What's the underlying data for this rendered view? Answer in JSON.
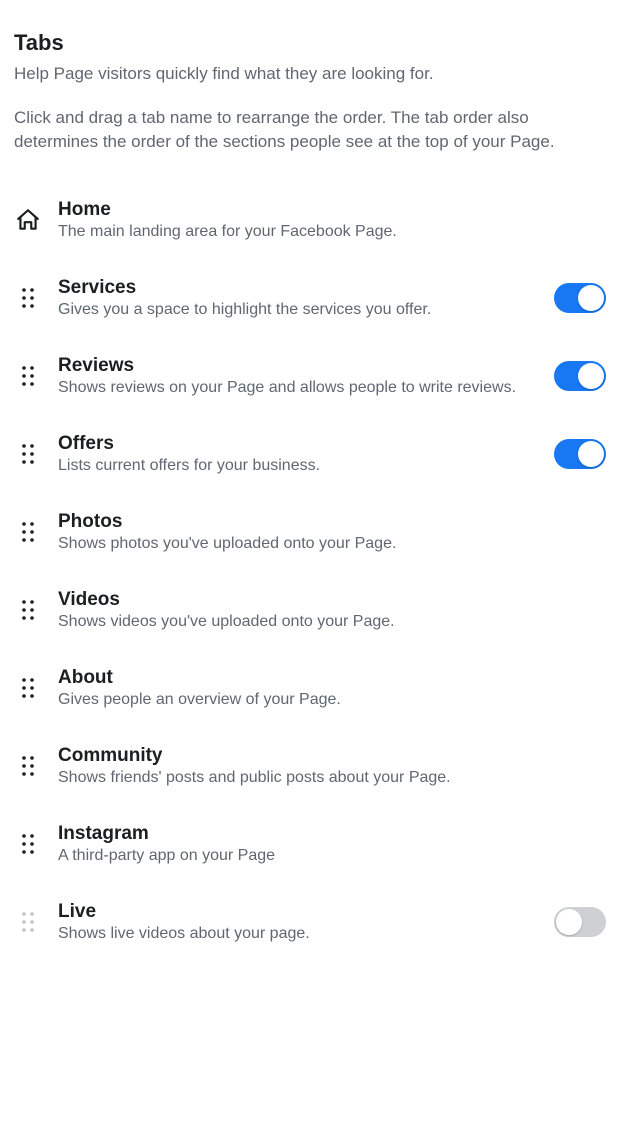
{
  "header": {
    "title": "Tabs",
    "help": "Help Page visitors quickly find what they are looking for.",
    "instruction": "Click and drag a tab name to rearrange the order. The tab order also determines the order of the sections people see at the top of your Page."
  },
  "tabs": [
    {
      "id": "home",
      "name": "Home",
      "desc": "The main landing area for your Facebook Page.",
      "icon": "home",
      "draggable": false,
      "toggle": null
    },
    {
      "id": "services",
      "name": "Services",
      "desc": "Gives you a space to highlight the services you offer.",
      "icon": "drag",
      "draggable": true,
      "toggle": "on"
    },
    {
      "id": "reviews",
      "name": "Reviews",
      "desc": "Shows reviews on your Page and allows people to write reviews.",
      "icon": "drag",
      "draggable": true,
      "toggle": "on"
    },
    {
      "id": "offers",
      "name": "Offers",
      "desc": "Lists current offers for your business.",
      "icon": "drag",
      "draggable": true,
      "toggle": "on"
    },
    {
      "id": "photos",
      "name": "Photos",
      "desc": "Shows photos you've uploaded onto your Page.",
      "icon": "drag",
      "draggable": true,
      "toggle": null
    },
    {
      "id": "videos",
      "name": "Videos",
      "desc": "Shows videos you've uploaded onto your Page.",
      "icon": "drag",
      "draggable": true,
      "toggle": null
    },
    {
      "id": "about",
      "name": "About",
      "desc": "Gives people an overview of your Page.",
      "icon": "drag",
      "draggable": true,
      "toggle": null
    },
    {
      "id": "community",
      "name": "Community",
      "desc": "Shows friends' posts and public posts about your Page.",
      "icon": "drag",
      "draggable": true,
      "toggle": null
    },
    {
      "id": "instagram",
      "name": "Instagram",
      "desc": "A third-party app on your Page",
      "icon": "drag",
      "draggable": true,
      "toggle": null
    },
    {
      "id": "live",
      "name": "Live",
      "desc": "Shows live videos about your page.",
      "icon": "drag",
      "draggable": true,
      "dim": true,
      "toggle": "off"
    }
  ],
  "colors": {
    "accent": "#1877f2",
    "text_primary": "#1c1e21",
    "text_secondary": "#606770",
    "toggle_off": "#ced0d4"
  }
}
